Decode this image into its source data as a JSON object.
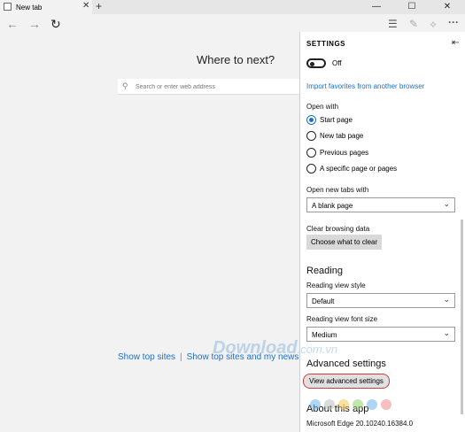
{
  "tab": {
    "title": "New tab"
  },
  "window": {
    "minimize": "—",
    "maximize": "☐",
    "close": "✕"
  },
  "nav": {
    "back": "←",
    "forward": "→",
    "refresh": "↻"
  },
  "toolbar": {
    "hub": "☰",
    "note": "✎",
    "share": "⟡",
    "more": "···"
  },
  "page": {
    "heading": "Where to next?",
    "search_placeholder": "Search or enter web address",
    "link_top_sites": "Show top sites",
    "separator": "|",
    "link_top_sites_news": "Show top sites and my news feed"
  },
  "settings": {
    "title": "SETTINGS",
    "toggle_label": "Off",
    "import_link": "Import favorites from another browser",
    "open_with_label": "Open with",
    "open_with_options": [
      {
        "label": "Start page",
        "checked": true
      },
      {
        "label": "New tab page",
        "checked": false
      },
      {
        "label": "Previous pages",
        "checked": false
      },
      {
        "label": "A specific page or pages",
        "checked": false
      }
    ],
    "new_tabs_label": "Open new tabs with",
    "new_tabs_value": "A blank page",
    "clear_label": "Clear browsing data",
    "clear_button": "Choose what to clear",
    "reading_heading": "Reading",
    "reading_style_label": "Reading view style",
    "reading_style_value": "Default",
    "reading_font_label": "Reading view font size",
    "reading_font_value": "Medium",
    "advanced_heading": "Advanced settings",
    "advanced_button": "View advanced settings",
    "about_heading": "About this app",
    "version": "Microsoft Edge 20.10240.16384.0"
  },
  "watermark": {
    "text": "Download",
    "suffix": ".com.vn"
  },
  "colors": {
    "accent": "#1f6fc9",
    "highlight_ring": "#d23b3b"
  }
}
